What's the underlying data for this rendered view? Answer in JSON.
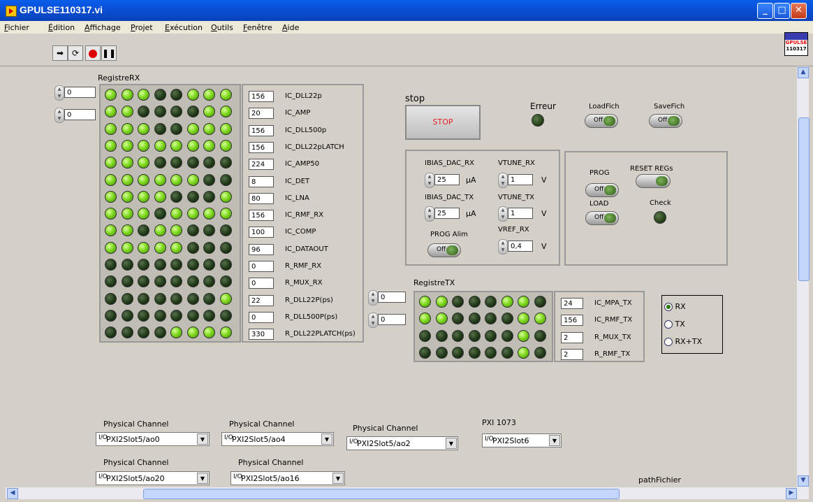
{
  "window": {
    "title": "GPULSE110317.vi",
    "icon_text_1": "GPULSE",
    "icon_text_2": "110317"
  },
  "menu": [
    "Fichier",
    "Édition",
    "Affichage",
    "Projet",
    "Exécution",
    "Outils",
    "Fenêtre",
    "Aide"
  ],
  "toolbar": {
    "buttons": [
      "run-arrow-icon",
      "run-continuous-icon",
      "abort-icon",
      "pause-icon"
    ]
  },
  "registre_rx": {
    "label": "RegistreRX",
    "index_row": "0",
    "index_col": "0",
    "rows": [
      [
        1,
        1,
        1,
        0,
        0,
        1,
        1,
        1
      ],
      [
        1,
        1,
        0,
        0,
        0,
        0,
        1,
        1
      ],
      [
        1,
        1,
        1,
        0,
        0,
        1,
        1,
        1
      ],
      [
        1,
        1,
        1,
        1,
        1,
        1,
        1,
        1
      ],
      [
        1,
        1,
        1,
        0,
        0,
        0,
        0,
        0
      ],
      [
        1,
        1,
        1,
        1,
        1,
        1,
        0,
        0
      ],
      [
        1,
        1,
        1,
        1,
        0,
        0,
        0,
        1
      ],
      [
        1,
        1,
        1,
        0,
        1,
        1,
        1,
        1
      ],
      [
        1,
        1,
        0,
        1,
        1,
        0,
        0,
        0
      ],
      [
        1,
        1,
        1,
        1,
        1,
        0,
        0,
        0
      ],
      [
        0,
        0,
        0,
        0,
        0,
        0,
        0,
        0
      ],
      [
        0,
        0,
        0,
        0,
        0,
        0,
        0,
        0
      ],
      [
        0,
        0,
        0,
        0,
        0,
        0,
        0,
        1
      ],
      [
        0,
        0,
        0,
        0,
        0,
        0,
        0,
        0
      ],
      [
        0,
        0,
        0,
        0,
        1,
        1,
        1,
        1
      ]
    ],
    "fields": [
      {
        "value": "156",
        "label": "IC_DLL22p"
      },
      {
        "value": "20",
        "label": "IC_AMP"
      },
      {
        "value": "156",
        "label": "IC_DLL500p"
      },
      {
        "value": "156",
        "label": "IC_DLL22pLATCH"
      },
      {
        "value": "224",
        "label": "IC_AMP50"
      },
      {
        "value": "8",
        "label": "IC_DET"
      },
      {
        "value": "80",
        "label": "IC_LNA"
      },
      {
        "value": "156",
        "label": "IC_RMF_RX"
      },
      {
        "value": "100",
        "label": "IC_COMP"
      },
      {
        "value": "96",
        "label": "IC_DATAOUT"
      },
      {
        "value": "0",
        "label": "R_RMF_RX"
      },
      {
        "value": "0",
        "label": "R_MUX_RX"
      },
      {
        "value": "22",
        "label": "R_DLL22P(ps)"
      },
      {
        "value": "0",
        "label": "R_DLL500P(ps)"
      },
      {
        "value": "330",
        "label": "R_DLL22PLATCH(ps)"
      }
    ]
  },
  "registre_tx": {
    "label": "RegistreTX",
    "index_row": "0",
    "index_col": "0",
    "rows": [
      [
        1,
        1,
        0,
        0,
        0,
        1,
        1,
        0
      ],
      [
        1,
        1,
        0,
        0,
        0,
        0,
        1,
        1
      ],
      [
        0,
        0,
        0,
        0,
        0,
        0,
        1,
        0
      ],
      [
        0,
        0,
        0,
        0,
        0,
        0,
        1,
        0
      ]
    ],
    "fields": [
      {
        "value": "24",
        "label": "IC_MPA_TX"
      },
      {
        "value": "156",
        "label": "IC_RMF_TX"
      },
      {
        "value": "2",
        "label": "R_MUX_TX"
      },
      {
        "value": "2",
        "label": "R_RMF_TX"
      }
    ]
  },
  "stop": {
    "label": "stop",
    "button": "STOP"
  },
  "erreur": {
    "label": "Erreur"
  },
  "loadfich": {
    "label": "LoadFich",
    "state": "Off"
  },
  "savefich": {
    "label": "SaveFich",
    "state": "Off"
  },
  "bias": {
    "ibias_dac_rx": {
      "label": "IBIAS_DAC_RX",
      "value": "25",
      "unit": "µA"
    },
    "ibias_dac_tx": {
      "label": "IBIAS_DAC_TX",
      "value": "25",
      "unit": "µA"
    },
    "vtune_rx": {
      "label": "VTUNE_RX",
      "value": "1",
      "unit": "V"
    },
    "vtune_tx": {
      "label": "VTUNE_TX",
      "value": "1",
      "unit": "V"
    },
    "vref_rx": {
      "label": "VREF_RX",
      "value": "0,4",
      "unit": "V"
    },
    "prog_alim": {
      "label": "PROG Alim",
      "state": "Off"
    }
  },
  "prog_panel": {
    "prog": {
      "label": "PROG",
      "state": "Off"
    },
    "load": {
      "label": "LOAD",
      "state": "Off"
    },
    "reset": {
      "label": "RESET REGs"
    },
    "check": {
      "label": "Check"
    }
  },
  "mode": {
    "options": [
      "RX",
      "TX",
      "RX+TX"
    ],
    "selected": "RX"
  },
  "channels": [
    {
      "label": "Physical Channel",
      "value": "PXI2Slot5/ao0"
    },
    {
      "label": "Physical Channel",
      "value": "PXI2Slot5/ao4"
    },
    {
      "label": "Physical Channel",
      "value": "PXI2Slot5/ao2"
    },
    {
      "label": "PXI 1073",
      "value": "PXI2Slot6"
    },
    {
      "label": "Physical Channel",
      "value": "PXI2Slot5/ao20"
    },
    {
      "label": "Physical Channel",
      "value": "PXI2Slot5/ao16"
    }
  ],
  "path": {
    "label": "pathFichier"
  },
  "colors": {
    "led_on": "#7fd81f",
    "led_off": "#203a18",
    "stop_text": "#e02020",
    "titlebar": "#0a5ee8"
  }
}
